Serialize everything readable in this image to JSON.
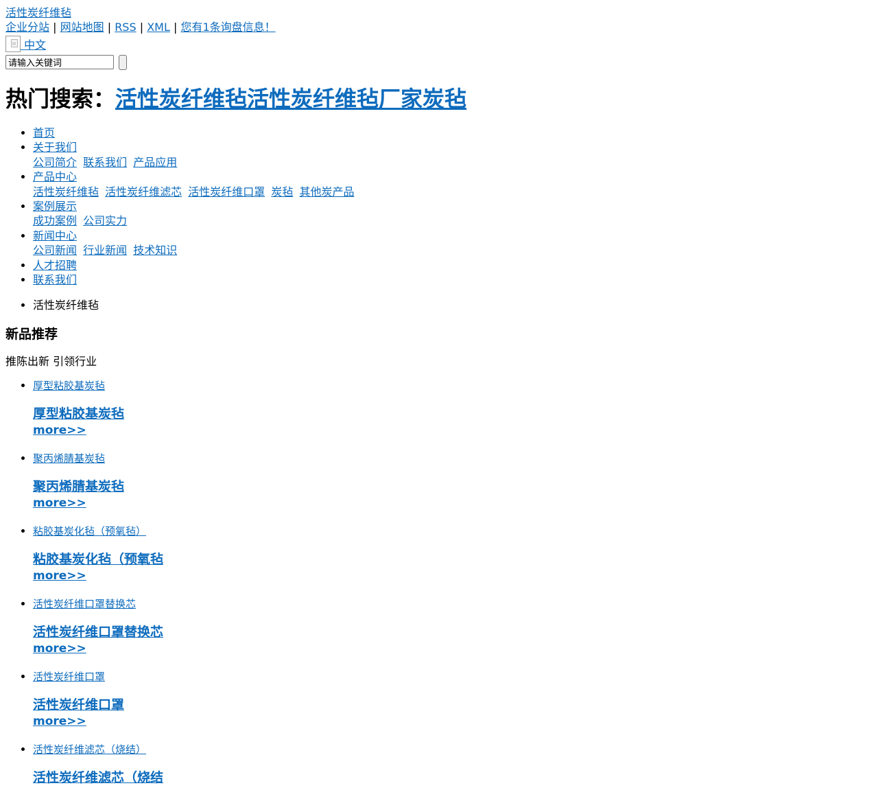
{
  "header": {
    "site_title": "活性炭纤维毡",
    "top_links": [
      {
        "label": "企业分站"
      },
      {
        "label": "网站地图"
      },
      {
        "label": "RSS"
      },
      {
        "label": "XML"
      },
      {
        "label": "您有1条询盘信息！"
      }
    ],
    "separator": "|",
    "language": "中文"
  },
  "search": {
    "placeholder": "请输入关键词",
    "value": "请输入关键词"
  },
  "hot_search": {
    "prefix": "热门搜索：",
    "keywords": [
      "活性炭纤维毡",
      "活性炭纤维毡厂家",
      "炭毡"
    ]
  },
  "nav": {
    "items": [
      {
        "label": "首页",
        "children": []
      },
      {
        "label": "关于我们",
        "children": [
          "公司简介",
          "联系我们",
          "产品应用"
        ]
      },
      {
        "label": "产品中心",
        "children": [
          "活性炭纤维毡",
          "活性炭纤维滤芯",
          "活性炭纤维口罩",
          "炭毡",
          "其他炭产品"
        ]
      },
      {
        "label": "案例展示",
        "children": [
          "成功案例",
          "公司实力"
        ]
      },
      {
        "label": "新闻中心",
        "children": [
          "公司新闻",
          "行业新闻",
          "技术知识"
        ]
      },
      {
        "label": "人才招聘",
        "children": []
      },
      {
        "label": "联系我们",
        "children": []
      }
    ]
  },
  "breadcrumb": {
    "current": "活性炭纤维毡"
  },
  "new_products": {
    "title": "新品推荐",
    "subtitle": "推陈出新 引领行业",
    "more_label": "more>>",
    "items": [
      {
        "link": "厚型粘胶基炭毡",
        "title": "厚型粘胶基炭毡"
      },
      {
        "link": "聚丙烯腈基炭毡",
        "title": "聚丙烯腈基炭毡"
      },
      {
        "link": "粘胶基炭化毡（预氧毡）",
        "title": "粘胶基炭化毡（预氧毡"
      },
      {
        "link": "活性炭纤维口罩替换芯",
        "title": "活性炭纤维口罩替换芯"
      },
      {
        "link": "活性炭纤维口罩",
        "title": "活性炭纤维口罩"
      },
      {
        "link": "活性炭纤维滤芯（烧结）",
        "title": "活性炭纤维滤芯（烧结"
      }
    ]
  }
}
